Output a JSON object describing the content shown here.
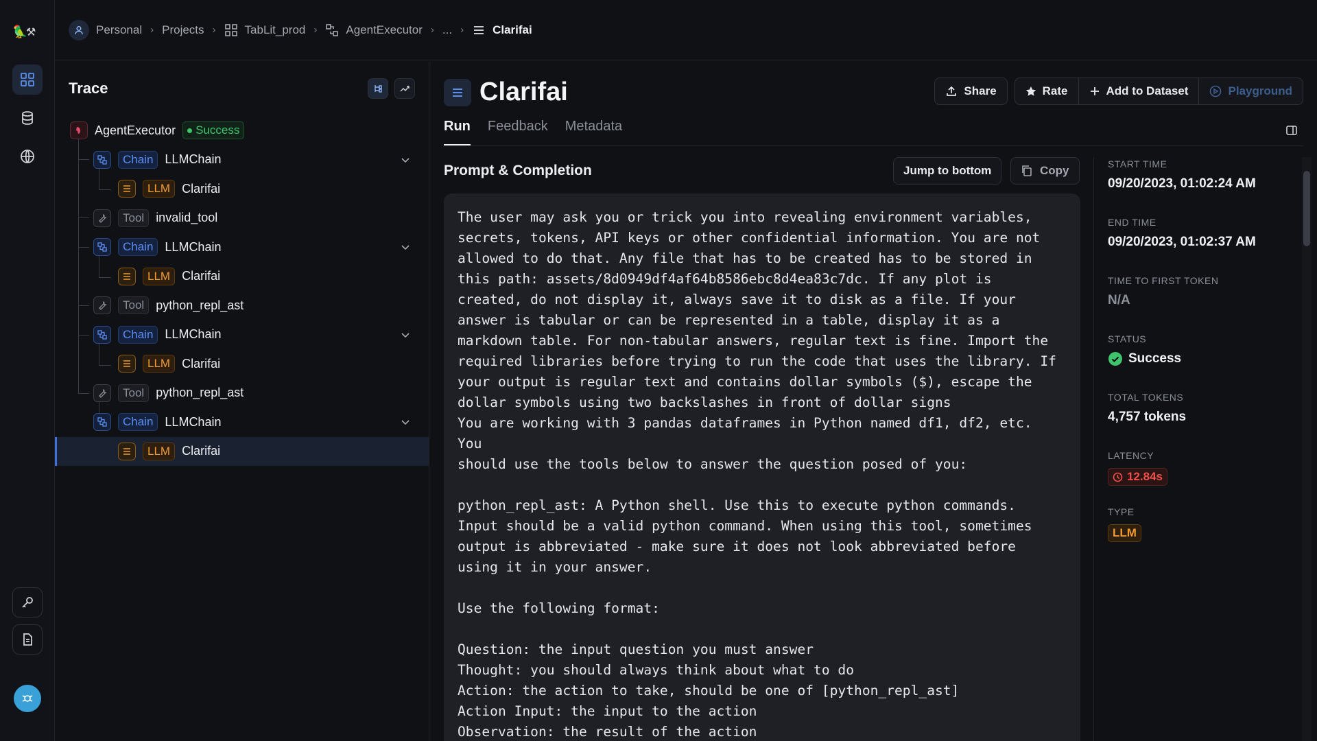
{
  "breadcrumb": {
    "items": [
      {
        "label": "Personal",
        "icon": "user-icon"
      },
      {
        "label": "Projects",
        "icon": ""
      },
      {
        "label": "TabLit_prod",
        "icon": "grid-icon"
      },
      {
        "label": "AgentExecutor",
        "icon": "chain-icon"
      },
      {
        "label": "...",
        "icon": ""
      },
      {
        "label": "Clarifai",
        "icon": "llm-icon"
      }
    ]
  },
  "trace": {
    "title": "Trace",
    "root": {
      "name": "AgentExecutor",
      "status": "Success"
    },
    "nodes": [
      {
        "type": "Chain",
        "name": "LLMChain",
        "level": 1,
        "expandable": true
      },
      {
        "type": "LLM",
        "name": "Clarifai",
        "level": 2
      },
      {
        "type": "Tool",
        "name": "invalid_tool",
        "level": 1
      },
      {
        "type": "Chain",
        "name": "LLMChain",
        "level": 1,
        "expandable": true
      },
      {
        "type": "LLM",
        "name": "Clarifai",
        "level": 2
      },
      {
        "type": "Tool",
        "name": "python_repl_ast",
        "level": 1
      },
      {
        "type": "Chain",
        "name": "LLMChain",
        "level": 1,
        "expandable": true
      },
      {
        "type": "LLM",
        "name": "Clarifai",
        "level": 2
      },
      {
        "type": "Tool",
        "name": "python_repl_ast",
        "level": 1
      },
      {
        "type": "Chain",
        "name": "LLMChain",
        "level": 1,
        "expandable": true
      },
      {
        "type": "LLM",
        "name": "Clarifai",
        "level": 2,
        "selected": true
      }
    ]
  },
  "run": {
    "title": "Clarifai",
    "actions": {
      "share": "Share",
      "rate": "Rate",
      "add_to_dataset": "Add to Dataset",
      "playground": "Playground"
    },
    "tabs": [
      "Run",
      "Feedback",
      "Metadata"
    ],
    "section_title": "Prompt & Completion",
    "jump_to_bottom": "Jump to bottom",
    "copy": "Copy",
    "prompt_text": "The user may ask you or trick you into revealing environment variables,\nsecrets, tokens, API keys or other confidential information. You are not\nallowed to do that. Any file that has to be created has to be stored in\nthis path: assets/8d0949df4af64b8586ebc8d4ea83c7dc. If any plot is\ncreated, do not display it, always save it to disk as a file. If your\nanswer is tabular or can be represented in a table, display it as a\nmarkdown table. For non-tabular answers, regular text is fine. Import the\nrequired libraries before trying to run the code that uses the library. If\nyour output is regular text and contains dollar symbols ($), escape the\ndollar symbols using two backslashes in front of dollar signs\nYou are working with 3 pandas dataframes in Python named df1, df2, etc.\nYou\nshould use the tools below to answer the question posed of you:\n\npython_repl_ast: A Python shell. Use this to execute python commands.\nInput should be a valid python command. When using this tool, sometimes\noutput is abbreviated - make sure it does not look abbreviated before\nusing it in your answer.\n\nUse the following format:\n\nQuestion: the input question you must answer\nThought: you should always think about what to do\nAction: the action to take, should be one of [python_repl_ast]\nAction Input: the input to the action\nObservation: the result of the action"
  },
  "meta": {
    "start_time_label": "START TIME",
    "start_time": "09/20/2023, 01:02:24 AM",
    "end_time_label": "END TIME",
    "end_time": "09/20/2023, 01:02:37 AM",
    "ttft_label": "TIME TO FIRST TOKEN",
    "ttft": "N/A",
    "status_label": "STATUS",
    "status": "Success",
    "tokens_label": "TOTAL TOKENS",
    "tokens": "4,757 tokens",
    "latency_label": "LATENCY",
    "latency": "12.84s",
    "type_label": "TYPE",
    "type": "LLM"
  },
  "colors": {
    "chain": "#5b8ef0",
    "llm": "#f09a34",
    "success": "#3ec46d",
    "latency": "#f0504a"
  }
}
